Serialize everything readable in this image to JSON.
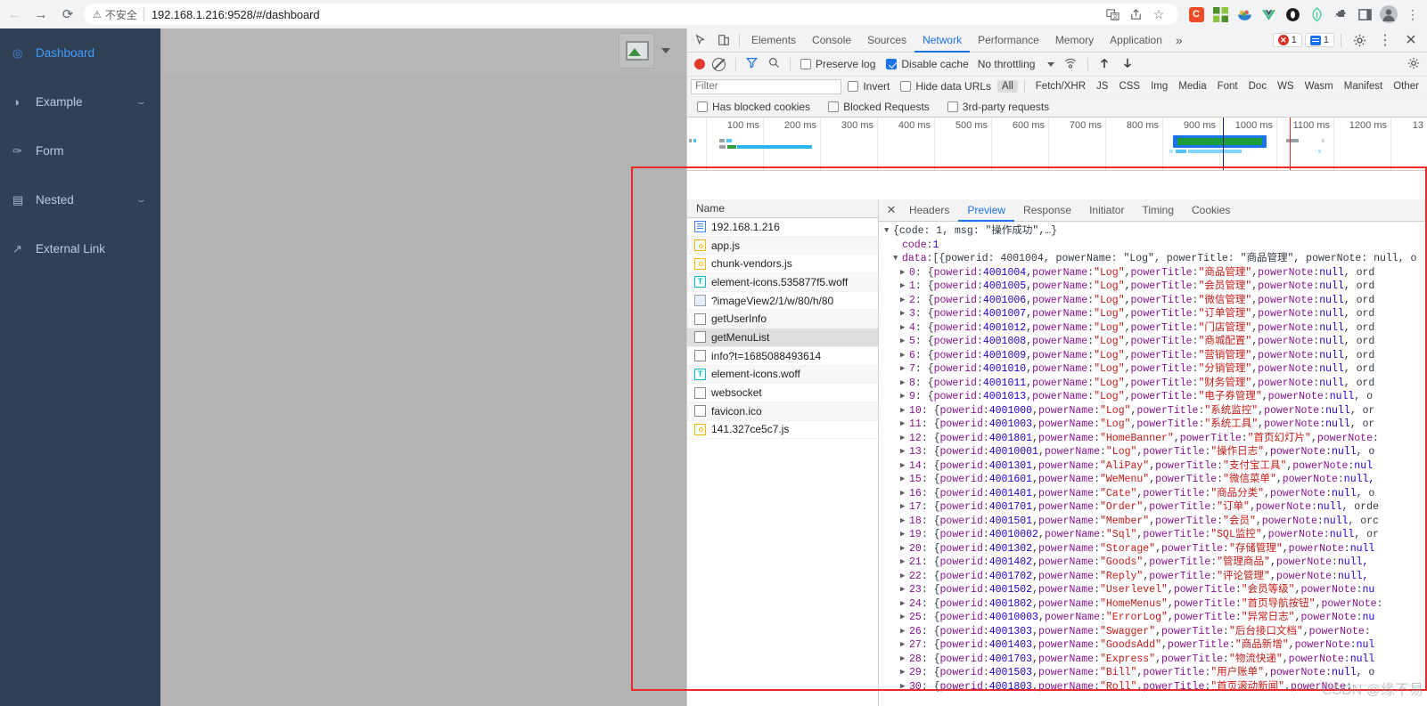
{
  "browser": {
    "nav": {
      "back": "←",
      "forward": "→",
      "reload": "⟳"
    },
    "security_icon": "warning-triangle-icon",
    "security_text": "不安全",
    "url": "192.168.1.216:9528/#/dashboard",
    "toolbar_icons": [
      {
        "name": "translate-icon",
        "glyph": "🗎"
      },
      {
        "name": "share-icon",
        "glyph": "⇱"
      },
      {
        "name": "bookmark-star-icon",
        "glyph": "☆"
      },
      {
        "name": "extension-c-icon",
        "glyph": "C",
        "color": "#f04b27"
      },
      {
        "name": "extension-grid-icon",
        "glyph": "⊞",
        "color": "#7bc043"
      },
      {
        "name": "extension-fruit-icon",
        "glyph": "◕",
        "color": "#e8a33d"
      },
      {
        "name": "extension-vue-icon",
        "glyph": "V",
        "color": "#42b883"
      },
      {
        "name": "extension-ring-icon",
        "glyph": "◉",
        "color": "#2b2b2b"
      },
      {
        "name": "extension-leaf-icon",
        "glyph": "◊",
        "color": "#3ecf8e"
      },
      {
        "name": "extensions-puzzle-icon",
        "glyph": "✦"
      },
      {
        "name": "sidepanel-icon",
        "glyph": "▯"
      },
      {
        "name": "profile-avatar-icon",
        "glyph": "●"
      },
      {
        "name": "chrome-menu-icon",
        "glyph": "⋮"
      }
    ]
  },
  "app": {
    "sidebar": {
      "items": [
        {
          "label": "Dashboard",
          "icon": "dashboard-icon",
          "glyph": "◎",
          "active": true,
          "expandable": false
        },
        {
          "label": "Example",
          "icon": "example-icon",
          "glyph": "◑",
          "active": false,
          "expandable": true
        },
        {
          "label": "Form",
          "icon": "form-icon",
          "glyph": "✎",
          "active": false,
          "expandable": false
        },
        {
          "label": "Nested",
          "icon": "nested-icon",
          "glyph": "☰",
          "active": false,
          "expandable": true
        },
        {
          "label": "External Link",
          "icon": "external-link-icon",
          "glyph": "↗",
          "active": false,
          "expandable": false
        }
      ],
      "chevron": "⌄"
    },
    "navbar": {
      "avatar_alt": "broken-image-placeholder",
      "dropdown_caret": "▼"
    }
  },
  "devtools": {
    "header": {
      "inspect_icon": "inspect-element-icon",
      "device_icon": "device-toolbar-icon",
      "tabs": [
        {
          "label": "Elements",
          "active": false
        },
        {
          "label": "Console",
          "active": false
        },
        {
          "label": "Sources",
          "active": false
        },
        {
          "label": "Network",
          "active": true
        },
        {
          "label": "Performance",
          "active": false
        },
        {
          "label": "Memory",
          "active": false
        },
        {
          "label": "Application",
          "active": false
        }
      ],
      "more_tabs": "»",
      "error_count": "1",
      "message_count": "1",
      "settings_icon": "gear-icon",
      "menu_icon": "kebab-menu-icon",
      "close_icon": "close-icon"
    },
    "network_toolbar": {
      "record_label": "record-button",
      "clear_label": "clear-button",
      "filter_icon": "funnel-icon",
      "search_icon": "search-icon",
      "preserve_log": {
        "label": "Preserve log",
        "checked": false
      },
      "disable_cache": {
        "label": "Disable cache",
        "checked": true
      },
      "throttling": "No throttling",
      "wifi_icon": "network-conditions-icon",
      "import_icon": "import-har-icon",
      "export_icon": "export-har-icon",
      "settings_icon": "network-settings-gear-icon"
    },
    "filter_bar": {
      "filter_placeholder": "Filter",
      "filter_value": "",
      "invert": {
        "label": "Invert",
        "checked": false
      },
      "hide_data_urls": {
        "label": "Hide data URLs",
        "checked": false
      },
      "types": [
        {
          "label": "All",
          "selected": true
        },
        {
          "label": "Fetch/XHR",
          "selected": false
        },
        {
          "label": "JS",
          "selected": false
        },
        {
          "label": "CSS",
          "selected": false
        },
        {
          "label": "Img",
          "selected": false
        },
        {
          "label": "Media",
          "selected": false
        },
        {
          "label": "Font",
          "selected": false
        },
        {
          "label": "Doc",
          "selected": false
        },
        {
          "label": "WS",
          "selected": false
        },
        {
          "label": "Wasm",
          "selected": false
        },
        {
          "label": "Manifest",
          "selected": false
        },
        {
          "label": "Other",
          "selected": false
        }
      ],
      "has_blocked_cookies": {
        "label": "Has blocked cookies",
        "checked": false
      },
      "blocked_requests": {
        "label": "Blocked Requests",
        "checked": false
      },
      "third_party": {
        "label": "3rd-party requests",
        "checked": false
      }
    },
    "overview": {
      "ticks": [
        "100 ms",
        "200 ms",
        "300 ms",
        "400 ms",
        "500 ms",
        "600 ms",
        "700 ms",
        "800 ms",
        "900 ms",
        "1000 ms",
        "1100 ms",
        "1200 ms",
        "13"
      ]
    },
    "request_table": {
      "column_header": "Name",
      "rows": [
        {
          "name": "192.168.1.216",
          "type": "doc",
          "selected": false
        },
        {
          "name": "app.js",
          "type": "js",
          "selected": false
        },
        {
          "name": "chunk-vendors.js",
          "type": "js",
          "selected": false
        },
        {
          "name": "element-icons.535877f5.woff",
          "type": "font",
          "selected": false
        },
        {
          "name": "?imageView2/1/w/80/h/80",
          "type": "img",
          "selected": false
        },
        {
          "name": "getUserInfo",
          "type": "other",
          "selected": false
        },
        {
          "name": "getMenuList",
          "type": "other",
          "selected": true
        },
        {
          "name": "info?t=1685088493614",
          "type": "other",
          "selected": false
        },
        {
          "name": "element-icons.woff",
          "type": "font",
          "selected": false
        },
        {
          "name": "websocket",
          "type": "other",
          "selected": false
        },
        {
          "name": "favicon.ico",
          "type": "other",
          "selected": false
        },
        {
          "name": "141.327ce5c7.js",
          "type": "js",
          "selected": false
        }
      ]
    },
    "detail_tabs": {
      "close": "✕",
      "tabs": [
        {
          "label": "Headers",
          "active": false
        },
        {
          "label": "Preview",
          "active": true
        },
        {
          "label": "Response",
          "active": false
        },
        {
          "label": "Initiator",
          "active": false
        },
        {
          "label": "Timing",
          "active": false
        },
        {
          "label": "Cookies",
          "active": false
        }
      ]
    },
    "preview_json": {
      "root_line": "{code: 1, msg: \"操作成功\",…}",
      "code_key": "code",
      "code_value": "1",
      "data_key": "data",
      "data_preview": "[{powerid: 4001004, powerName: \"Log\", powerTitle: \"商品管理\", powerNote: null, o",
      "items": [
        {
          "index": "0",
          "powerid": "4001004",
          "powerName": "Log",
          "powerTitle": "商品管理",
          "tail": "ord"
        },
        {
          "index": "1",
          "powerid": "4001005",
          "powerName": "Log",
          "powerTitle": "会员管理",
          "tail": "ord"
        },
        {
          "index": "2",
          "powerid": "4001006",
          "powerName": "Log",
          "powerTitle": "微信管理",
          "tail": "ord"
        },
        {
          "index": "3",
          "powerid": "4001007",
          "powerName": "Log",
          "powerTitle": "订单管理",
          "tail": "ord"
        },
        {
          "index": "4",
          "powerid": "4001012",
          "powerName": "Log",
          "powerTitle": "门店管理",
          "tail": "ord"
        },
        {
          "index": "5",
          "powerid": "4001008",
          "powerName": "Log",
          "powerTitle": "商城配置",
          "tail": "ord"
        },
        {
          "index": "6",
          "powerid": "4001009",
          "powerName": "Log",
          "powerTitle": "营销管理",
          "tail": "ord"
        },
        {
          "index": "7",
          "powerid": "4001010",
          "powerName": "Log",
          "powerTitle": "分销管理",
          "tail": "ord"
        },
        {
          "index": "8",
          "powerid": "4001011",
          "powerName": "Log",
          "powerTitle": "财务管理",
          "tail": "ord"
        },
        {
          "index": "9",
          "powerid": "4001013",
          "powerName": "Log",
          "powerTitle": "电子券管理",
          "tail": "o"
        },
        {
          "index": "10",
          "powerid": "4001000",
          "powerName": "Log",
          "powerTitle": "系统监控",
          "tail": "or"
        },
        {
          "index": "11",
          "powerid": "4001003",
          "powerName": "Log",
          "powerTitle": "系统工具",
          "tail": "or"
        },
        {
          "index": "12",
          "powerid": "4001801",
          "powerName": "HomeBanner",
          "powerTitle": "首页幻灯片",
          "tail": "",
          "note_trunc": true
        },
        {
          "index": "13",
          "powerid": "40010001",
          "powerName": "Log",
          "powerTitle": "操作日志",
          "tail": "o"
        },
        {
          "index": "14",
          "powerid": "4001301",
          "powerName": "AliPay",
          "powerTitle": "支付宝工具",
          "tail": "",
          "note_partial": "nul"
        },
        {
          "index": "15",
          "powerid": "4001601",
          "powerName": "WeMenu",
          "powerTitle": "微信菜单",
          "tail": "",
          "note_partial": "null,"
        },
        {
          "index": "16",
          "powerid": "4001401",
          "powerName": "Cate",
          "powerTitle": "商品分类",
          "tail": "o"
        },
        {
          "index": "17",
          "powerid": "4001701",
          "powerName": "Order",
          "powerTitle": "订单",
          "tail": "orde"
        },
        {
          "index": "18",
          "powerid": "4001501",
          "powerName": "Member",
          "powerTitle": "会员",
          "tail": "orc"
        },
        {
          "index": "19",
          "powerid": "40010002",
          "powerName": "Sql",
          "powerTitle": "SQL监控",
          "tail": "or"
        },
        {
          "index": "20",
          "powerid": "4001302",
          "powerName": "Storage",
          "powerTitle": "存储管理",
          "tail": "",
          "note_partial": "null"
        },
        {
          "index": "21",
          "powerid": "4001402",
          "powerName": "Goods",
          "powerTitle": "管理商品",
          "tail": "",
          "note_partial": "null,"
        },
        {
          "index": "22",
          "powerid": "4001702",
          "powerName": "Reply",
          "powerTitle": "评论管理",
          "tail": "",
          "note_partial": "null,"
        },
        {
          "index": "23",
          "powerid": "4001502",
          "powerName": "Userlevel",
          "powerTitle": "会员等级",
          "tail": "",
          "note_partial": "nu"
        },
        {
          "index": "24",
          "powerid": "4001802",
          "powerName": "HomeMenus",
          "powerTitle": "首页导航按钮",
          "tail": "",
          "note_trunc": true
        },
        {
          "index": "25",
          "powerid": "40010003",
          "powerName": "ErrorLog",
          "powerTitle": "异常日志",
          "tail": "",
          "note_partial": "nu"
        },
        {
          "index": "26",
          "powerid": "4001303",
          "powerName": "Swagger",
          "powerTitle": "后台接口文档",
          "tail": "",
          "note_trunc": true
        },
        {
          "index": "27",
          "powerid": "4001403",
          "powerName": "GoodsAdd",
          "powerTitle": "商品新增",
          "tail": "",
          "note_partial": "nul"
        },
        {
          "index": "28",
          "powerid": "4001703",
          "powerName": "Express",
          "powerTitle": "物流快递",
          "tail": "",
          "note_partial": "null"
        },
        {
          "index": "29",
          "powerid": "4001503",
          "powerName": "Bill",
          "powerTitle": "用户账单",
          "tail": "o"
        },
        {
          "index": "30",
          "powerid": "4001803",
          "powerName": "Roll",
          "powerTitle": "首页滚动新闻",
          "tail": "",
          "note_trunc": true
        }
      ],
      "labels": {
        "powerid": "powerid",
        "powerName": "powerName",
        "powerTitle": "powerTitle",
        "powerNote": "powerNote",
        "null": "null"
      }
    },
    "annotation": {
      "rect_color": "#e8292e",
      "watermark": "CSDN @缘不易"
    }
  }
}
